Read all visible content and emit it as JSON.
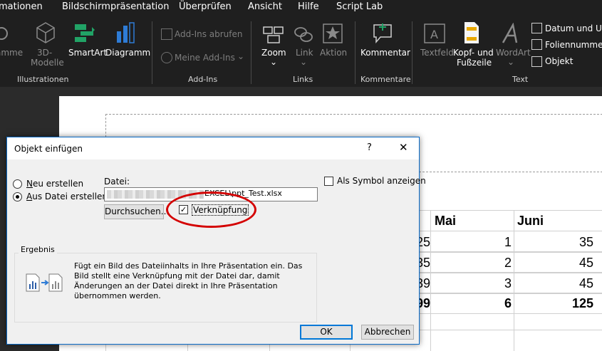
{
  "ribbon": {
    "tabs": [
      "mationen",
      "Bildschirmpräsentation",
      "Überprüfen",
      "Ansicht",
      "Hilfe",
      "Script Lab"
    ],
    "groups": {
      "illustrationen": {
        "label": "Illustrationen",
        "items": [
          "amme",
          "3D-",
          "Modelle",
          "SmartArt",
          "Diagramm"
        ]
      },
      "addins": {
        "label": "Add-Ins",
        "items": [
          "Add-Ins abrufen",
          "Meine Add-Ins"
        ]
      },
      "links": {
        "label": "Links",
        "items": [
          "Zoom",
          "Link",
          "Aktion"
        ]
      },
      "kommentare": {
        "label": "Kommentare",
        "items": [
          "Kommentar"
        ]
      },
      "text": {
        "label": "Text",
        "items": [
          "Textfeld",
          "Kopf- und",
          "Fußzeile",
          "WordArt",
          "Datum und Uhrze",
          "Foliennummer",
          "Objekt"
        ]
      }
    }
  },
  "table": {
    "headers": [
      "Mai",
      "Juni"
    ],
    "rows": [
      [
        "25",
        "1",
        "35"
      ],
      [
        "35",
        "2",
        "45"
      ],
      [
        "39",
        "3",
        "45"
      ],
      [
        "99",
        "6",
        "125"
      ]
    ]
  },
  "dialog": {
    "title": "Objekt einfügen",
    "help": "?",
    "close": "✕",
    "radio_new_prefix": "N",
    "radio_new_rest": "eu erstellen",
    "radio_file_prefix": "A",
    "radio_file_rest": "us Datei erstellen",
    "file_label": "Datei:",
    "file_value": "EXCEL\\ppt_Test.xlsx",
    "browse_button": "Durchsuchen...",
    "link_checkbox": "Verknüpfung",
    "symbol_checkbox": "Als Symbol anzeigen",
    "group_title": "Ergebnis",
    "result_text": "Fügt ein Bild des Dateiinhalts in Ihre Präsentation ein. Das Bild stellt eine Verknüpfung mit der Datei dar, damit Änderungen an der Datei direkt in Ihre Präsentation übernommen werden.",
    "ok_button": "OK",
    "cancel_button": "Abbrechen"
  }
}
